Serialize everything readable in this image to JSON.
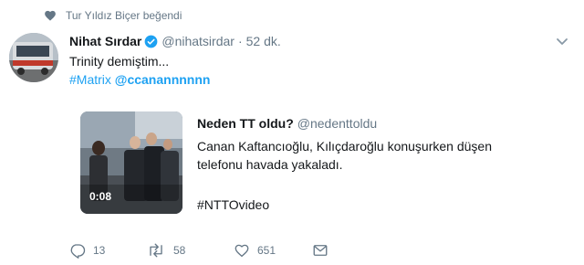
{
  "social_context": {
    "icon": "heart-icon",
    "text": "Tur Yıldız Biçer beğendi"
  },
  "tweet": {
    "author_name": "Nihat Sırdar",
    "verified_icon": "verified-badge-icon",
    "handle": "@nihatsirdar",
    "separator": "·",
    "time": "52 dk.",
    "text_line1": "Trinity demiştim...",
    "hashtag": "#Matrix",
    "mention": "@ccanannnnnn"
  },
  "quoted_tweet": {
    "author_name": "Neden TT oldu?",
    "handle": "@nedenttoldu",
    "text_line1": "Canan Kaftancıoğlu, Kılıçdaroğlu konuşurken düşen",
    "text_line2": "telefonu havada yakaladı.",
    "hashtag": "#NTTOvideo",
    "video_duration": "0:08"
  },
  "actions": {
    "reply_count": "13",
    "retweet_count": "58",
    "like_count": "651"
  },
  "colors": {
    "link": "#1da1f2",
    "secondary_text": "#657786",
    "primary_text": "#14171a"
  }
}
